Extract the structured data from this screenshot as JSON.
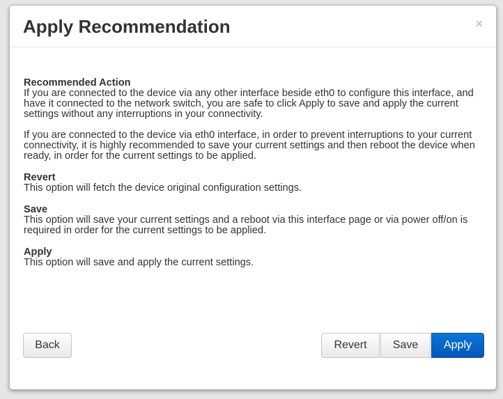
{
  "dialog": {
    "title": "Apply Recommendation",
    "close_label": "×"
  },
  "sections": {
    "recommended": {
      "heading": "Recommended Action",
      "paragraph1": "If you are connected to the device via any other interface beside eth0 to configure this interface, and have it connected to the network switch, you are safe to click Apply to save and apply the current settings without any interruptions in your connectivity.",
      "paragraph2": "If you are connected to the device via eth0 interface, in order to prevent interruptions to your current connectivity, it is highly recommended to save your current settings and then reboot the device when ready, in order for the current settings to be applied."
    },
    "revert": {
      "heading": "Revert",
      "text": "This option will fetch the device original configuration settings."
    },
    "save": {
      "heading": "Save",
      "text": "This option will save your current settings and a reboot via this interface page or via power off/on is required in order for the current settings to be applied."
    },
    "apply": {
      "heading": "Apply",
      "text": "This option will save and apply the current settings."
    }
  },
  "buttons": {
    "back": "Back",
    "revert": "Revert",
    "save": "Save",
    "apply": "Apply"
  },
  "colors": {
    "primary": "#0565cc",
    "text": "#333333"
  }
}
